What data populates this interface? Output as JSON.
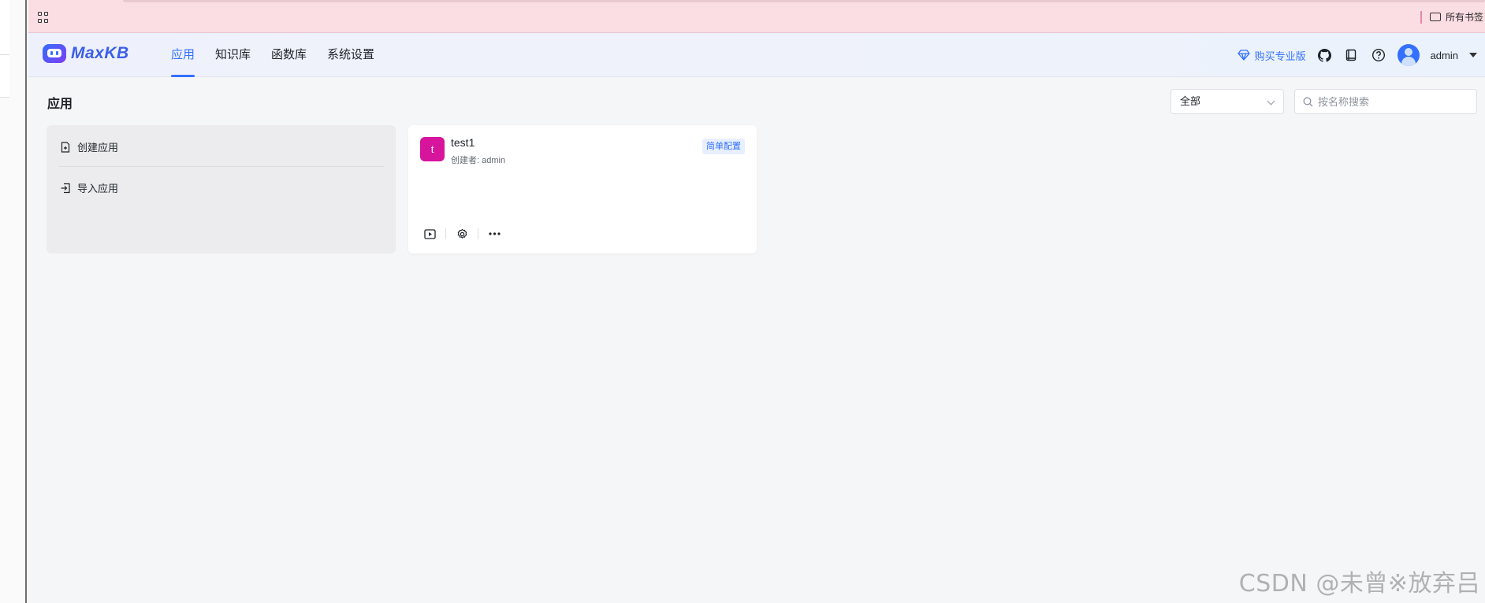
{
  "bookmarks_bar": {
    "folder_label": "所有书签"
  },
  "header": {
    "logo_text": "MaxKB",
    "nav": [
      {
        "label": "应用",
        "active": true
      },
      {
        "label": "知识库",
        "active": false
      },
      {
        "label": "函数库",
        "active": false
      },
      {
        "label": "系统设置",
        "active": false
      }
    ],
    "buy_pro_label": "购买专业版",
    "icons": [
      "github-icon",
      "docs-icon",
      "help-icon"
    ],
    "user_name": "admin"
  },
  "page": {
    "title": "应用",
    "filter_value": "全部",
    "search_placeholder": "按名称搜索"
  },
  "create_card": {
    "create_label": "创建应用",
    "import_label": "导入应用"
  },
  "apps": [
    {
      "avatar_letter": "t",
      "name": "test1",
      "creator": "创建者: admin",
      "tag": "简单配置",
      "avatar_color": "#d6149c"
    }
  ],
  "watermark": "CSDN @未曾※放弃吕",
  "colors": {
    "accent": "#3370ff",
    "bookmark_bar_bg": "#fbdde4",
    "page_bg": "#f5f6f8"
  }
}
